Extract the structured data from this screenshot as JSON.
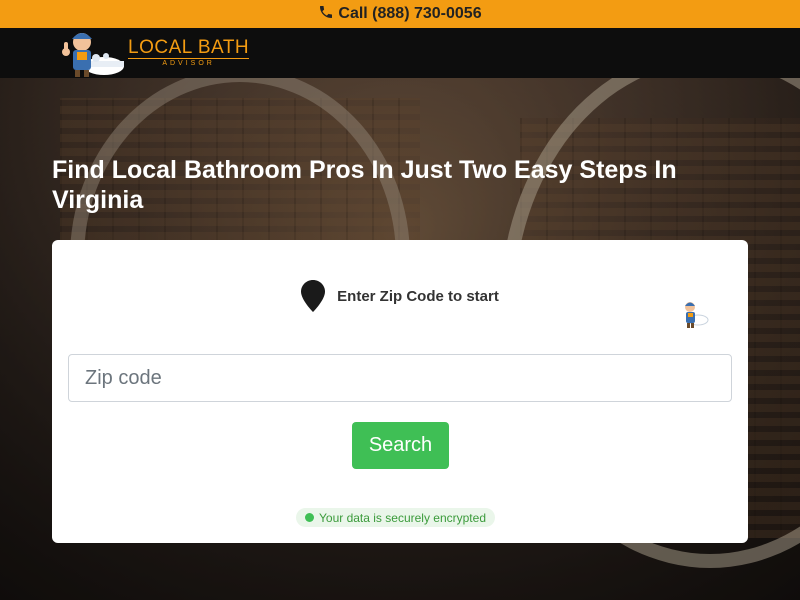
{
  "topbar": {
    "phone_label": "Call (888) 730-0056",
    "icon": "phone-icon",
    "background": "#f39c12"
  },
  "header": {
    "logo_main": "LOCAL BATH",
    "logo_sub": "ADVISOR",
    "logo_icon": "plumber-mascot-icon"
  },
  "hero": {
    "headline": "Find Local Bathroom Pros In Just Two Easy Steps In Virginia"
  },
  "form": {
    "step_label": "Enter Zip Code to start",
    "step_icon": "map-pin-icon",
    "zip_placeholder": "Zip code",
    "zip_value": "",
    "search_label": "Search",
    "secure_note": "Your data is securely encrypted",
    "accent": "#3fbf55"
  }
}
